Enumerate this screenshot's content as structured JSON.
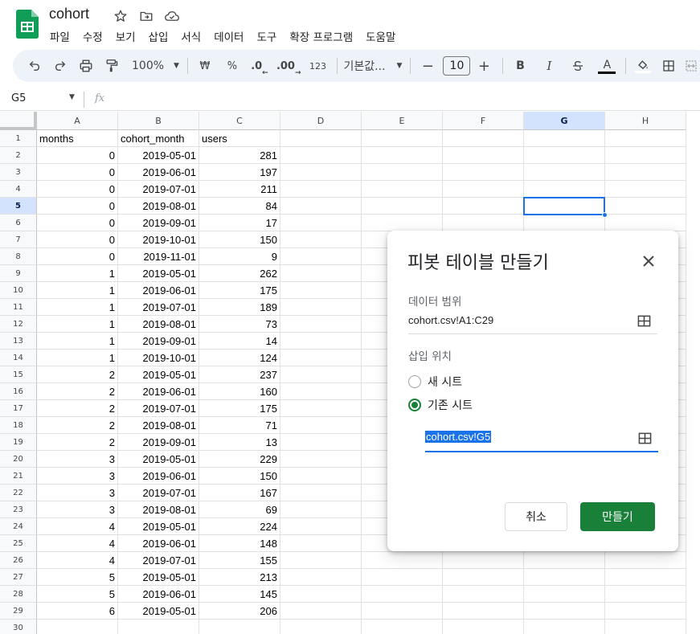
{
  "app": {
    "doc_title": "cohort",
    "brand_color": "#0f9d58",
    "title_icons": [
      "star-icon",
      "move-to-folder-icon",
      "cloud-status-icon"
    ]
  },
  "menu": [
    "파일",
    "수정",
    "보기",
    "삽입",
    "서식",
    "데이터",
    "도구",
    "확장 프로그램",
    "도움말"
  ],
  "toolbar": {
    "zoom": "100%",
    "currency": "₩",
    "percent": "%",
    "decrease_decimal": ".0",
    "increase_decimal": ".00",
    "number_format": "123",
    "font": "기본값...",
    "font_size": "10",
    "bold": "B",
    "italic": "I",
    "text_color_letter": "A"
  },
  "formula_bar": {
    "name_box": "G5",
    "fx": "fx"
  },
  "sheet": {
    "columns": [
      "A",
      "B",
      "C",
      "D",
      "E",
      "F",
      "G",
      "H"
    ],
    "selected_column": "G",
    "selected_row": 5,
    "selected_cell": "G5",
    "header_row": [
      "months",
      "cohort_month",
      "users"
    ],
    "rows": [
      [
        0,
        "2019-05-01",
        281
      ],
      [
        0,
        "2019-06-01",
        197
      ],
      [
        0,
        "2019-07-01",
        211
      ],
      [
        0,
        "2019-08-01",
        84
      ],
      [
        0,
        "2019-09-01",
        17
      ],
      [
        0,
        "2019-10-01",
        150
      ],
      [
        0,
        "2019-11-01",
        9
      ],
      [
        1,
        "2019-05-01",
        262
      ],
      [
        1,
        "2019-06-01",
        175
      ],
      [
        1,
        "2019-07-01",
        189
      ],
      [
        1,
        "2019-08-01",
        73
      ],
      [
        1,
        "2019-09-01",
        14
      ],
      [
        1,
        "2019-10-01",
        124
      ],
      [
        2,
        "2019-05-01",
        237
      ],
      [
        2,
        "2019-06-01",
        160
      ],
      [
        2,
        "2019-07-01",
        175
      ],
      [
        2,
        "2019-08-01",
        71
      ],
      [
        2,
        "2019-09-01",
        13
      ],
      [
        3,
        "2019-05-01",
        229
      ],
      [
        3,
        "2019-06-01",
        150
      ],
      [
        3,
        "2019-07-01",
        167
      ],
      [
        3,
        "2019-08-01",
        69
      ],
      [
        4,
        "2019-05-01",
        224
      ],
      [
        4,
        "2019-06-01",
        148
      ],
      [
        4,
        "2019-07-01",
        155
      ],
      [
        5,
        "2019-05-01",
        213
      ],
      [
        5,
        "2019-06-01",
        145
      ],
      [
        6,
        "2019-05-01",
        206
      ]
    ],
    "row_count": 30
  },
  "dialog": {
    "title": "피봇 테이블 만들기",
    "data_range_label": "데이터 범위",
    "data_range_value": "cohort.csv!A1:C29",
    "insert_location_label": "삽입 위치",
    "option_new_sheet": "새 시트",
    "option_existing_sheet": "기존 시트",
    "selected_option": "기존 시트",
    "location_value": "cohort.csv!G5",
    "cancel_label": "취소",
    "create_label": "만들기",
    "accent_color": "#188038"
  }
}
